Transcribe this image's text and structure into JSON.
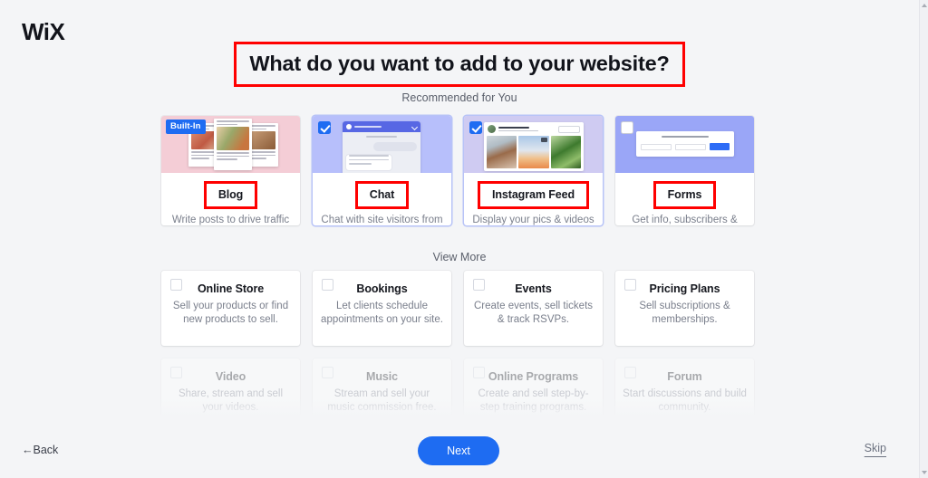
{
  "brand": {
    "logo_text": "WiX"
  },
  "header": {
    "title": "What do you want to add to your website?"
  },
  "sections": {
    "recommended_label": "Recommended for You",
    "view_more_label": "View More"
  },
  "badges": {
    "built_in": "Built-In"
  },
  "recommended": [
    {
      "title": "Blog",
      "desc": "Write posts to drive traffic and share your ideas.",
      "checked": false,
      "built_in": true,
      "thumb": "blog-thumbnail"
    },
    {
      "title": "Chat",
      "desc": "Chat with site visitors from desktop or mobile.",
      "checked": true,
      "built_in": false,
      "thumb": "chat-thumbnail"
    },
    {
      "title": "Instagram Feed",
      "desc": "Display your pics & videos from Instagram.",
      "checked": true,
      "built_in": false,
      "thumb": "instagram-thumbnail"
    },
    {
      "title": "Forms",
      "desc": "Get info, subscribers & payments with Forms.",
      "checked": false,
      "built_in": false,
      "thumb": "forms-thumbnail"
    }
  ],
  "view_more": [
    {
      "title": "Online Store",
      "desc": "Sell your products or find new products to sell.",
      "checked": false
    },
    {
      "title": "Bookings",
      "desc": "Let clients schedule appointments on your site.",
      "checked": false
    },
    {
      "title": "Events",
      "desc": "Create events, sell tickets & track RSVPs.",
      "checked": false
    },
    {
      "title": "Pricing Plans",
      "desc": "Sell subscriptions & memberships.",
      "checked": false
    }
  ],
  "view_more_partial": [
    {
      "title": "Video",
      "desc": "Share, stream and sell your videos.",
      "checked": false
    },
    {
      "title": "Music",
      "desc": "Stream and sell your music commission free.",
      "checked": false
    },
    {
      "title": "Online Programs",
      "desc": "Create and sell step-by-step training programs.",
      "checked": false
    },
    {
      "title": "Forum",
      "desc": "Start discussions and build community.",
      "checked": false
    }
  ],
  "footer": {
    "back_label": "←Back",
    "next_label": "Next",
    "skip_label": "Skip"
  },
  "colors": {
    "accent_blue": "#1e6cf2",
    "page_bg": "#f4f5f7",
    "annotation_red": "#ff0000",
    "title_text": "#16181f",
    "body_text": "#7a7f8c"
  }
}
